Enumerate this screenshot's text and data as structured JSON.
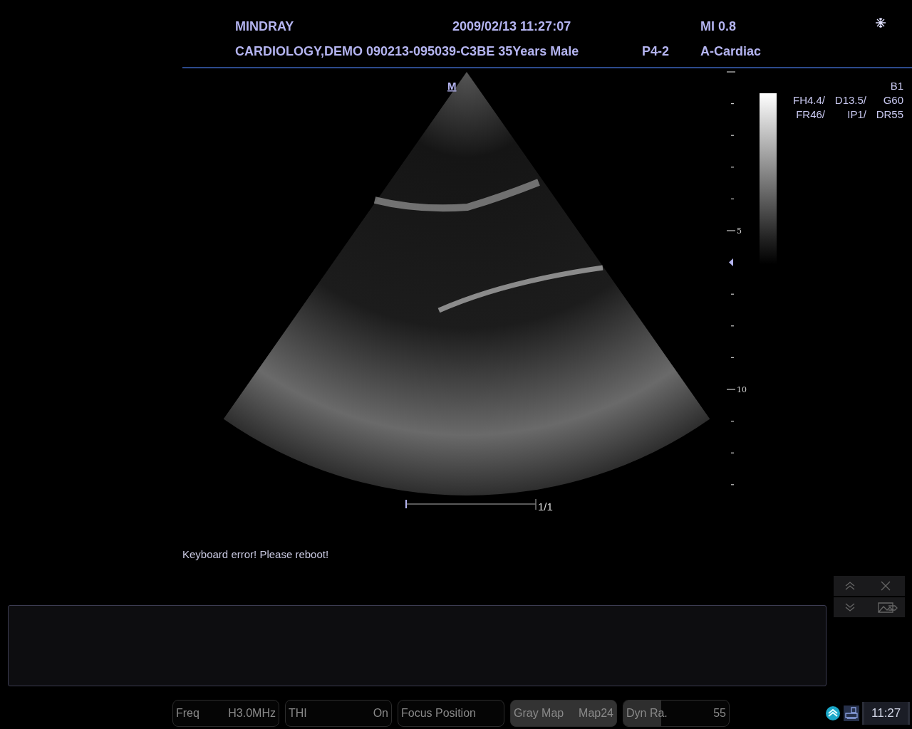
{
  "header": {
    "brand": "MINDRAY",
    "datetime": "2009/02/13 11:27:07",
    "mi": "MI 0.8",
    "patient": "CARDIOLOGY,DEMO 090213-095039-C3BE 35Years Male",
    "probe": "P4-2",
    "preset": "A-Cardiac"
  },
  "image": {
    "marker": "M",
    "frame_counter": "1/1",
    "depth_labels": [
      "5",
      "10"
    ]
  },
  "params": {
    "mode": "B1",
    "rows": [
      [
        "FH4.4/",
        "D13.5/",
        "G60"
      ],
      [
        "FR46/",
        "IP1/",
        "DR55"
      ]
    ]
  },
  "message": "Keyboard error! Please reboot!",
  "controls": [
    {
      "kind": "plain",
      "label": "Freq",
      "value": "H3.0MHz"
    },
    {
      "kind": "plain",
      "label": "THI",
      "value": "On"
    },
    {
      "kind": "plain",
      "label": "Focus Position"
    },
    {
      "kind": "highlighted",
      "label": "Gray Map",
      "value": "Map24"
    },
    {
      "kind": "slider",
      "label": "Dyn Ra.",
      "value": "55",
      "level": 0.36
    }
  ],
  "clock": "11:27"
}
